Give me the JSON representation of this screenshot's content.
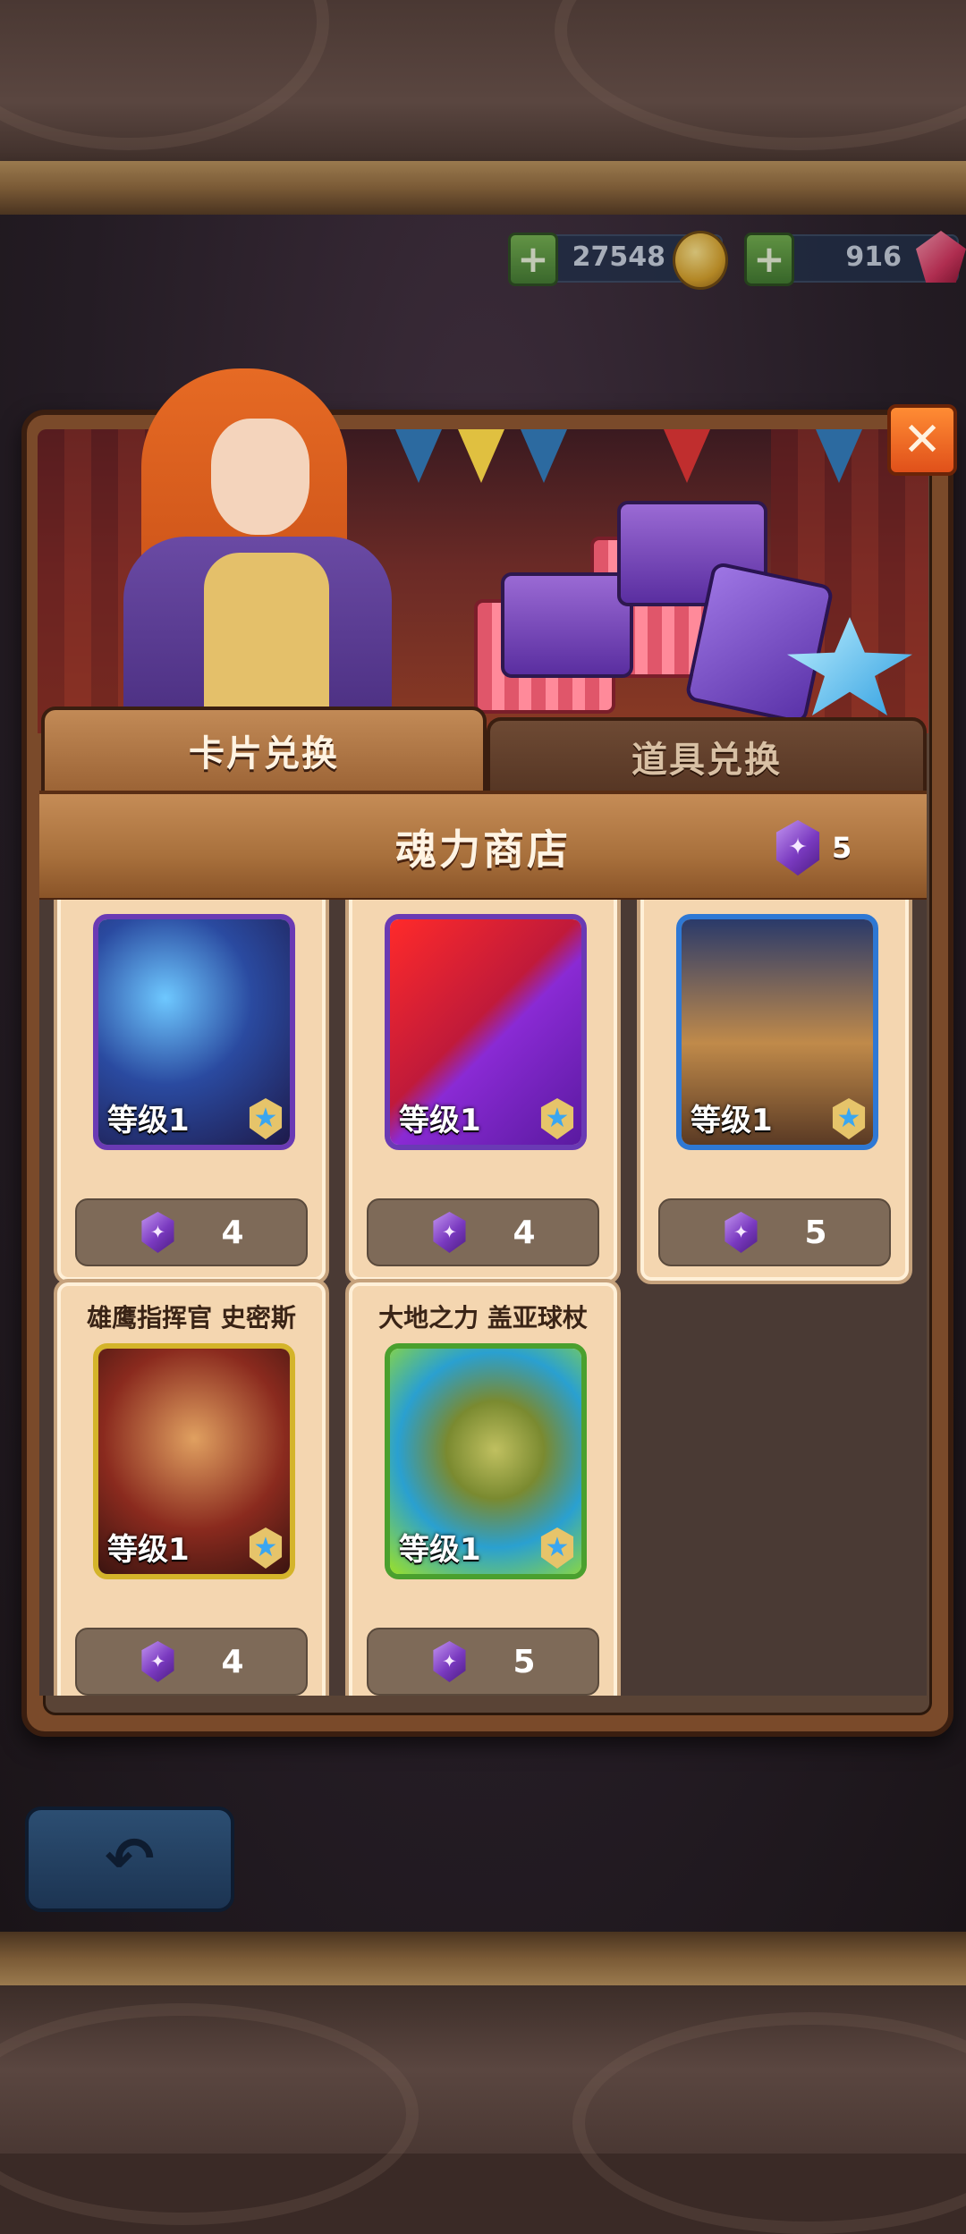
{
  "currency": {
    "gold": "27548",
    "gems": "916"
  },
  "tabs": [
    {
      "label": "卡片兑换",
      "active": true
    },
    {
      "label": "道具兑换",
      "active": false
    }
  ],
  "shop": {
    "title": "魂力商店",
    "soul_balance": "5"
  },
  "items": [
    {
      "name": "",
      "level": "等级1",
      "price": "4",
      "frame_color": "#6a3ab4",
      "art": "mage"
    },
    {
      "name": "",
      "level": "等级1",
      "price": "4",
      "frame_color": "#6a3ab4",
      "art": "claw"
    },
    {
      "name": "",
      "level": "等级1",
      "price": "5",
      "frame_color": "#2e78d4",
      "art": "engineer"
    },
    {
      "name": "雄鹰指挥官 史密斯",
      "level": "等级1",
      "price": "4",
      "frame_color": "#d4b42a",
      "art": "eagle"
    },
    {
      "name": "大地之力 盖亚球杖",
      "level": "等级1",
      "price": "5",
      "frame_color": "#4aa02e",
      "art": "gaia"
    }
  ],
  "icons": {
    "close": "close-icon",
    "back": "back-arrow-icon",
    "soul": "soul-gem-icon",
    "gold": "gold-coin-icon",
    "gem": "ruby-gem-icon",
    "add": "plus-icon"
  }
}
